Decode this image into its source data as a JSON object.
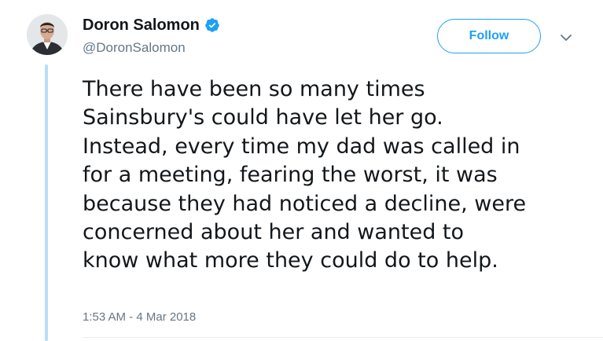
{
  "user": {
    "display_name": "Doron Salomon",
    "handle": "@DoronSalomon",
    "verified": true
  },
  "actions": {
    "follow_label": "Follow"
  },
  "tweet": {
    "lines": [
      "There have been so many times",
      "Sainsbury's could have let her go.",
      "Instead, every time my dad was called in",
      "for a meeting, fearing the worst, it was",
      "because they had noticed a decline, were",
      "concerned about her and wanted to",
      "know what more they could do to help."
    ],
    "timestamp": "1:53 AM - 4 Mar 2018"
  },
  "colors": {
    "accent": "#1da1f2",
    "thread_line": "#b5dff7",
    "secondary_text": "#657786",
    "primary_text": "#14171a"
  },
  "icons": {
    "verified": "verified-badge-icon",
    "caret": "chevron-down-icon"
  }
}
